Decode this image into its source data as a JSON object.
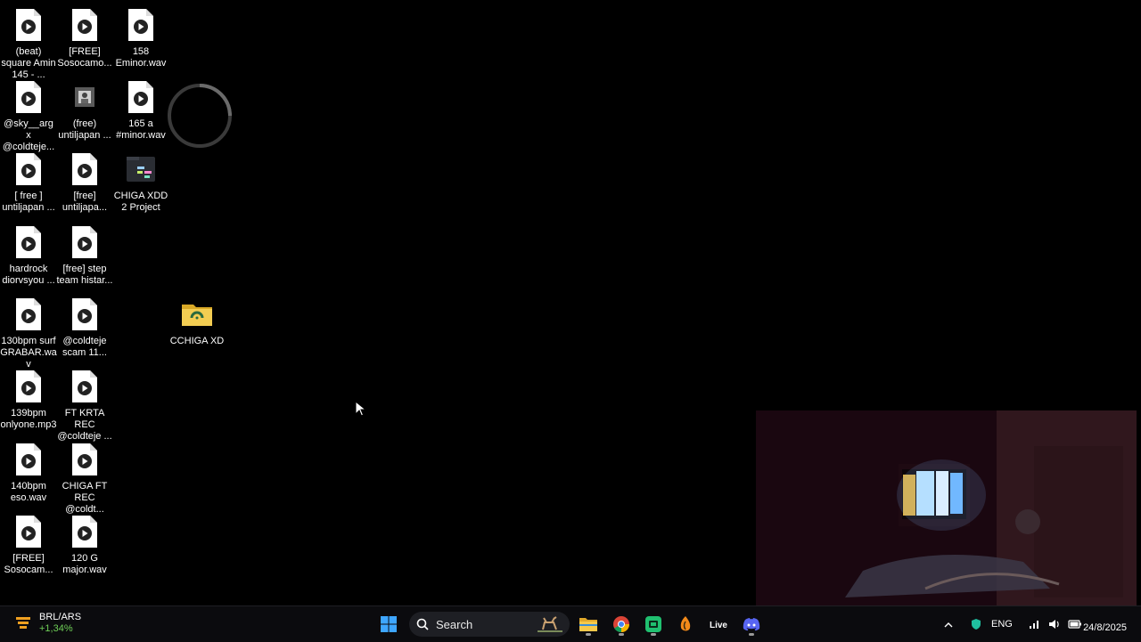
{
  "desktop_icons": [
    {
      "label": "(beat) square Amin 145 - ...",
      "type": "audio"
    },
    {
      "label": "[FREE] Sosocamo...",
      "type": "audio"
    },
    {
      "label": "158 Eminor.wav",
      "type": "audio"
    },
    {
      "label": "@sky__arg x @coldteje...",
      "type": "audio"
    },
    {
      "label": "(free) untiljapan ...",
      "type": "image"
    },
    {
      "label": "165 a #minor.wav",
      "type": "audio"
    },
    {
      "label": "[ free ] untiljapan ...",
      "type": "audio"
    },
    {
      "label": "[free] untiljapa...",
      "type": "audio"
    },
    {
      "label": "CHIGA XDD 2 Project",
      "type": "project"
    },
    {
      "label": "hardrock diorvsyou ...",
      "type": "audio"
    },
    {
      "label": "[free] step team histar...",
      "type": "audio"
    },
    {
      "label": "130bpm surf GRABAR.wav",
      "type": "audio"
    },
    {
      "label": "@coldteje scam 11...",
      "type": "audio"
    },
    {
      "label": "CCHIGA XD",
      "type": "folder"
    },
    {
      "label": "139bpm onlyone.mp3",
      "type": "audio"
    },
    {
      "label": "FT KRTA REC @coldteje ...",
      "type": "audio"
    },
    {
      "label": "140bpm eso.wav",
      "type": "audio"
    },
    {
      "label": "CHIGA FT REC @coldt...",
      "type": "audio"
    },
    {
      "label": "[FREE] Sosocam...",
      "type": "audio"
    },
    {
      "label": "120 G major.wav",
      "type": "audio"
    }
  ],
  "taskbar": {
    "widget": {
      "title": "BRL/ARS",
      "change": "+1,34%"
    },
    "search_placeholder": "Search",
    "tray": {
      "language": "ENG",
      "date": "24/8/2025"
    },
    "apps": [
      "windows-start",
      "file-explorer",
      "chrome",
      "app-green",
      "fl-studio",
      "ableton-live",
      "discord"
    ]
  },
  "colors": {
    "taskbar_bg": "#0b0b0e",
    "widget_positive": "#6fcf57",
    "folder": "#e8c44a"
  }
}
